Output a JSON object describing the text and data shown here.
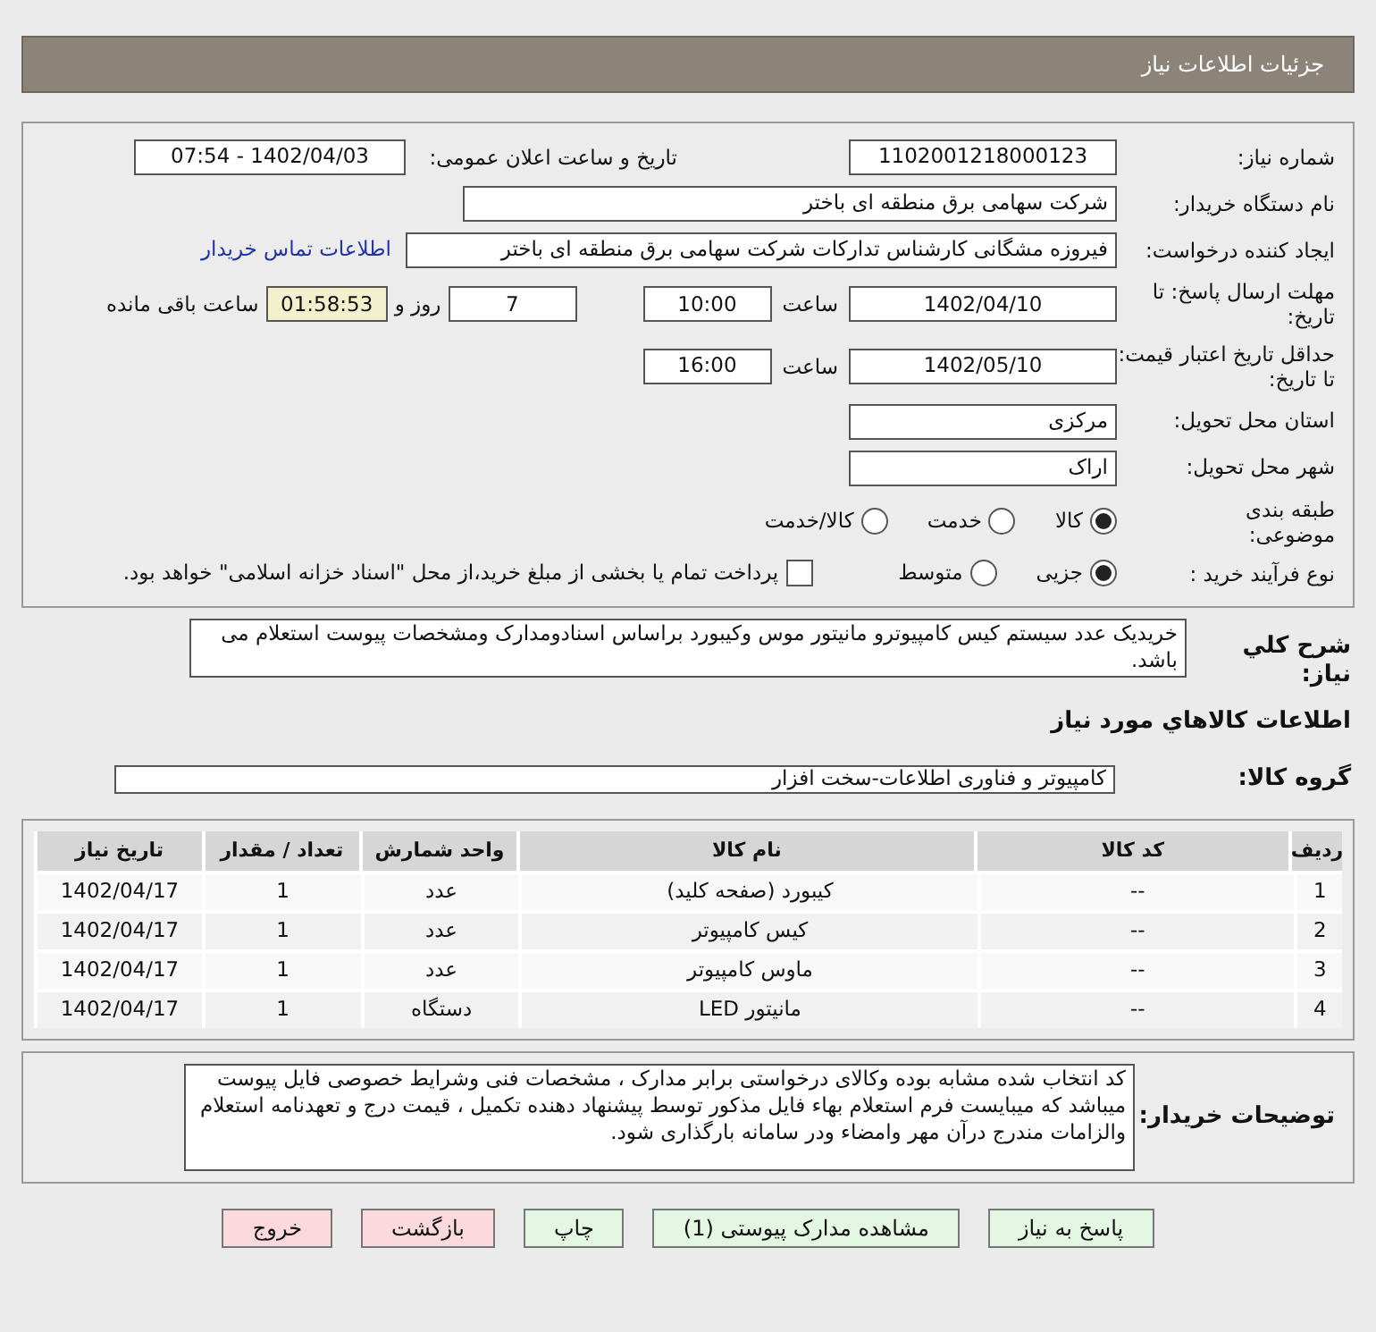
{
  "header": {
    "title": "جزئیات اطلاعات نیاز"
  },
  "need_number": {
    "label": "شماره نیاز:",
    "value": "1102001218000123"
  },
  "announce": {
    "label": "تاریخ و ساعت اعلان عمومی:",
    "value": "1402/04/03 - 07:54"
  },
  "buyer": {
    "label": "نام دستگاه خریدار:",
    "value": "شرکت سهامی برق منطقه ای باختر"
  },
  "requester": {
    "label": "ایجاد کننده درخواست:",
    "value": "فیروزه مشگانی کارشناس تدارکات شرکت سهامی برق منطقه ای باختر",
    "link": "اطلاعات تماس خریدار"
  },
  "deadline": {
    "label": "مهلت ارسال پاسخ: تا تاریخ:",
    "date": "1402/04/10",
    "time_label": "ساعت",
    "time": "10:00",
    "days": "7",
    "days_label": "روز و",
    "remaining": "01:58:53",
    "remaining_label": "ساعت باقی مانده"
  },
  "validity": {
    "label": "حداقل تاریخ اعتبار قیمت: تا تاریخ:",
    "date": "1402/05/10",
    "time_label": "ساعت",
    "time": "16:00"
  },
  "province": {
    "label": "استان محل تحویل:",
    "value": "مرکزی"
  },
  "city": {
    "label": "شهر محل تحویل:",
    "value": "اراک"
  },
  "category": {
    "label": "طبقه بندی موضوعی:",
    "options": [
      {
        "label": "کالا",
        "selected": true
      },
      {
        "label": "خدمت",
        "selected": false
      },
      {
        "label": "کالا/خدمت",
        "selected": false
      }
    ]
  },
  "process": {
    "label": "نوع فرآیند خرید :",
    "options": [
      {
        "label": "جزیی",
        "selected": true
      },
      {
        "label": "متوسط",
        "selected": false
      }
    ],
    "checkbox": {
      "label": "پرداخت تمام یا بخشی از مبلغ خرید،از محل \"اسناد خزانه اسلامی\" خواهد بود.",
      "checked": false
    }
  },
  "description": {
    "label": "شرح کلي نیاز:",
    "text": "خریدیک عدد سیستم کیس کامپیوترو مانیتور موس وکیبورد  براساس اسنادومدارک ومشخصات پیوست استعلام می باشد."
  },
  "goods_heading": "اطلاعات کالاهاي مورد نیاز",
  "group": {
    "label": "گروه کالا:",
    "value": "کامپیوتر و فناوری اطلاعات-سخت افزار"
  },
  "table": {
    "columns": [
      "ردیف",
      "کد کالا",
      "نام کالا",
      "واحد شمارش",
      "تعداد / مقدار",
      "تاریخ نیاز"
    ],
    "rows": [
      [
        "1",
        "--",
        "کیبورد (صفحه کلید)",
        "عدد",
        "1",
        "1402/04/17"
      ],
      [
        "2",
        "--",
        "کیس کامپیوتر",
        "عدد",
        "1",
        "1402/04/17"
      ],
      [
        "3",
        "--",
        "ماوس کامپیوتر",
        "عدد",
        "1",
        "1402/04/17"
      ],
      [
        "4",
        "--",
        "مانیتور LED",
        "دستگاه",
        "1",
        "1402/04/17"
      ]
    ]
  },
  "buyer_notes": {
    "label": "توضیحات خریدار:",
    "text": "کد انتخاب شده مشابه بوده وکالای درخواستی برابر مدارک ، مشخصات فنی وشرایط خصوصی فایل پیوست میباشد که میبایست فرم استعلام بهاء فایل مذکور توسط پیشنهاد دهنده تکمیل ، قیمت درج و تعهدنامه استعلام والزامات  مندرج درآن مهر وامضاء ودر سامانه بارگذاری شود."
  },
  "buttons": [
    {
      "label": "پاسخ به نیاز",
      "color": "#e3f7e3"
    },
    {
      "label": "مشاهده مدارک پیوستی (1)",
      "color": "#e3f7e3"
    },
    {
      "label": "چاپ",
      "color": "#e3f7e3"
    },
    {
      "label": "بازگشت",
      "color": "#fbd9dc"
    },
    {
      "label": "خروج",
      "color": "#fbd9dc"
    }
  ]
}
